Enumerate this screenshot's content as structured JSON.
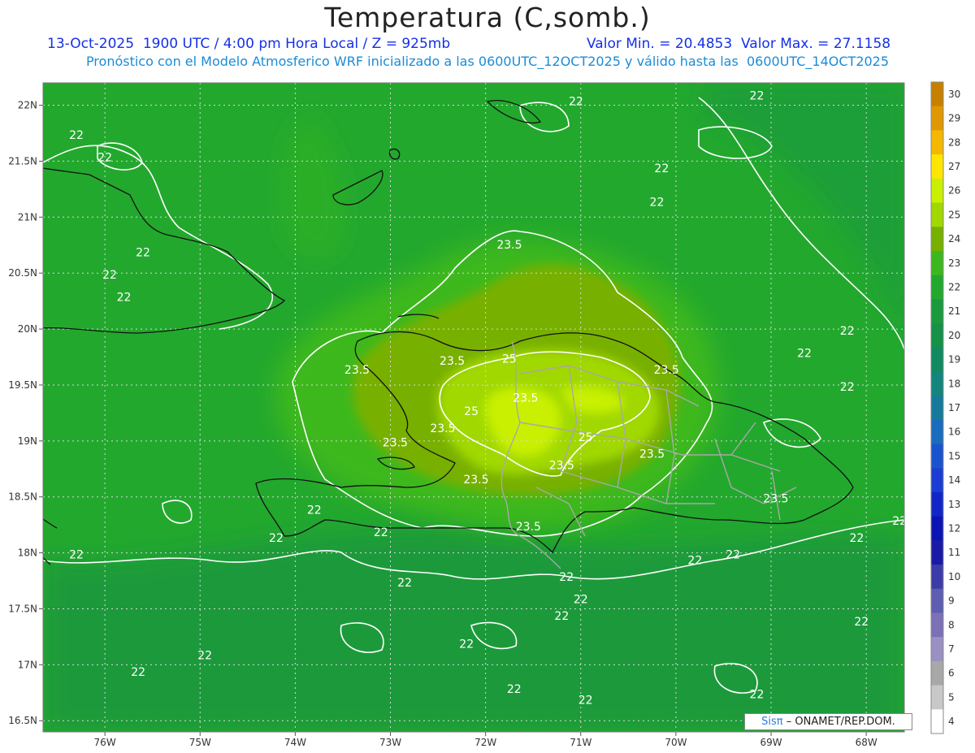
{
  "header": {
    "title": "Temperatura (C,somb.)",
    "date_line": "13-Oct-2025  1900 UTC / 4:00 pm Hora Local / Z = 925mb",
    "minmax_line": "Valor Min. = 20.4853  Valor Max. = 27.1158",
    "model_line": "Pronóstico con el Modelo Atmosferico WRF inicializado a las 0600UTC_12OCT2025 y válido hasta las  0600UTC_14OCT2025"
  },
  "axes": {
    "lat_ticks": [
      "22N",
      "21.5N",
      "21N",
      "20.5N",
      "20N",
      "19.5N",
      "19N",
      "18.5N",
      "18N",
      "17.5N",
      "17N",
      "16.5N"
    ],
    "lon_ticks": [
      "76W",
      "75W",
      "74W",
      "73W",
      "72W",
      "71W",
      "70W",
      "69W",
      "68W"
    ],
    "lat_range": [
      16.4,
      22.2
    ],
    "lon_range": [
      -76.65,
      -67.6
    ]
  },
  "colorbar": {
    "levels": [
      "30",
      "29",
      "28",
      "27",
      "26",
      "25",
      "24",
      "23",
      "22",
      "21",
      "20",
      "19",
      "18",
      "17",
      "16",
      "15",
      "14",
      "13",
      "12",
      "11",
      "10",
      "9",
      "8",
      "7",
      "6",
      "5",
      "4"
    ],
    "colors": [
      "#c77f00",
      "#e09800",
      "#f4b800",
      "#ffe600",
      "#c8f000",
      "#a0d800",
      "#78b000",
      "#3cb81e",
      "#23a82e",
      "#1a9a3c",
      "#159148",
      "#108a60",
      "#14857c",
      "#177a9a",
      "#1a6cbc",
      "#1a54cc",
      "#1a3ed4",
      "#1226c8",
      "#0c14b4",
      "#1a1aa6",
      "#3c3ca8",
      "#5e5eb0",
      "#7c70b6",
      "#9a90c2",
      "#a8a8a8",
      "#c8c8c8",
      "#ffffff"
    ]
  },
  "contours": {
    "labels": [
      {
        "text": "22",
        "lon": -76.3,
        "lat": 21.7
      },
      {
        "text": "22",
        "lon": -76.0,
        "lat": 21.5
      },
      {
        "text": "22",
        "lon": -75.6,
        "lat": 20.65
      },
      {
        "text": "22",
        "lon": -75.95,
        "lat": 20.45
      },
      {
        "text": "22",
        "lon": -75.8,
        "lat": 20.25
      },
      {
        "text": "22",
        "lon": -71.05,
        "lat": 22.0
      },
      {
        "text": "22",
        "lon": -70.15,
        "lat": 21.4
      },
      {
        "text": "22",
        "lon": -70.2,
        "lat": 21.1
      },
      {
        "text": "22",
        "lon": -69.15,
        "lat": 22.05
      },
      {
        "text": "22",
        "lon": -68.2,
        "lat": 19.95
      },
      {
        "text": "22",
        "lon": -68.65,
        "lat": 19.75
      },
      {
        "text": "22",
        "lon": -68.2,
        "lat": 19.45
      },
      {
        "text": "22",
        "lon": -73.8,
        "lat": 18.35
      },
      {
        "text": "22",
        "lon": -74.2,
        "lat": 18.1
      },
      {
        "text": "22",
        "lon": -76.3,
        "lat": 17.95
      },
      {
        "text": "22",
        "lon": -73.1,
        "lat": 18.15
      },
      {
        "text": "22",
        "lon": -71.15,
        "lat": 17.75
      },
      {
        "text": "22",
        "lon": -71.0,
        "lat": 17.55
      },
      {
        "text": "22",
        "lon": -72.85,
        "lat": 17.7
      },
      {
        "text": "22",
        "lon": -71.2,
        "lat": 17.4
      },
      {
        "text": "22",
        "lon": -72.2,
        "lat": 17.15
      },
      {
        "text": "22",
        "lon": -74.95,
        "lat": 17.05
      },
      {
        "text": "22",
        "lon": -75.65,
        "lat": 16.9
      },
      {
        "text": "22",
        "lon": -71.7,
        "lat": 16.75
      },
      {
        "text": "22",
        "lon": -70.95,
        "lat": 16.65
      },
      {
        "text": "22",
        "lon": -69.15,
        "lat": 16.7
      },
      {
        "text": "22",
        "lon": -68.05,
        "lat": 17.35
      },
      {
        "text": "22",
        "lon": -69.8,
        "lat": 17.9
      },
      {
        "text": "22",
        "lon": -69.4,
        "lat": 17.95
      },
      {
        "text": "22",
        "lon": -68.1,
        "lat": 18.1
      },
      {
        "text": "22",
        "lon": -67.65,
        "lat": 18.25
      },
      {
        "text": "23.5",
        "lon": -71.75,
        "lat": 20.72
      },
      {
        "text": "23.5",
        "lon": -72.35,
        "lat": 19.68
      },
      {
        "text": "23.5",
        "lon": -73.35,
        "lat": 19.6
      },
      {
        "text": "23.5",
        "lon": -70.1,
        "lat": 19.6
      },
      {
        "text": "23.5",
        "lon": -72.45,
        "lat": 19.08
      },
      {
        "text": "23.5",
        "lon": -72.95,
        "lat": 18.95
      },
      {
        "text": "23.5",
        "lon": -72.1,
        "lat": 18.62
      },
      {
        "text": "23.5",
        "lon": -71.2,
        "lat": 18.75
      },
      {
        "text": "23.5",
        "lon": -70.25,
        "lat": 18.85
      },
      {
        "text": "23.5",
        "lon": -71.55,
        "lat": 18.2
      },
      {
        "text": "23.5",
        "lon": -68.95,
        "lat": 18.45
      },
      {
        "text": "25",
        "lon": -71.75,
        "lat": 19.7
      },
      {
        "text": "25",
        "lon": -72.15,
        "lat": 19.23
      },
      {
        "text": "25",
        "lon": -70.95,
        "lat": 19.0
      },
      {
        "text": "23.5",
        "lon": -71.58,
        "lat": 19.35
      }
    ]
  },
  "credit": {
    "brand": "Sisπ",
    "text": "– ONAMET/REP.DOM."
  }
}
